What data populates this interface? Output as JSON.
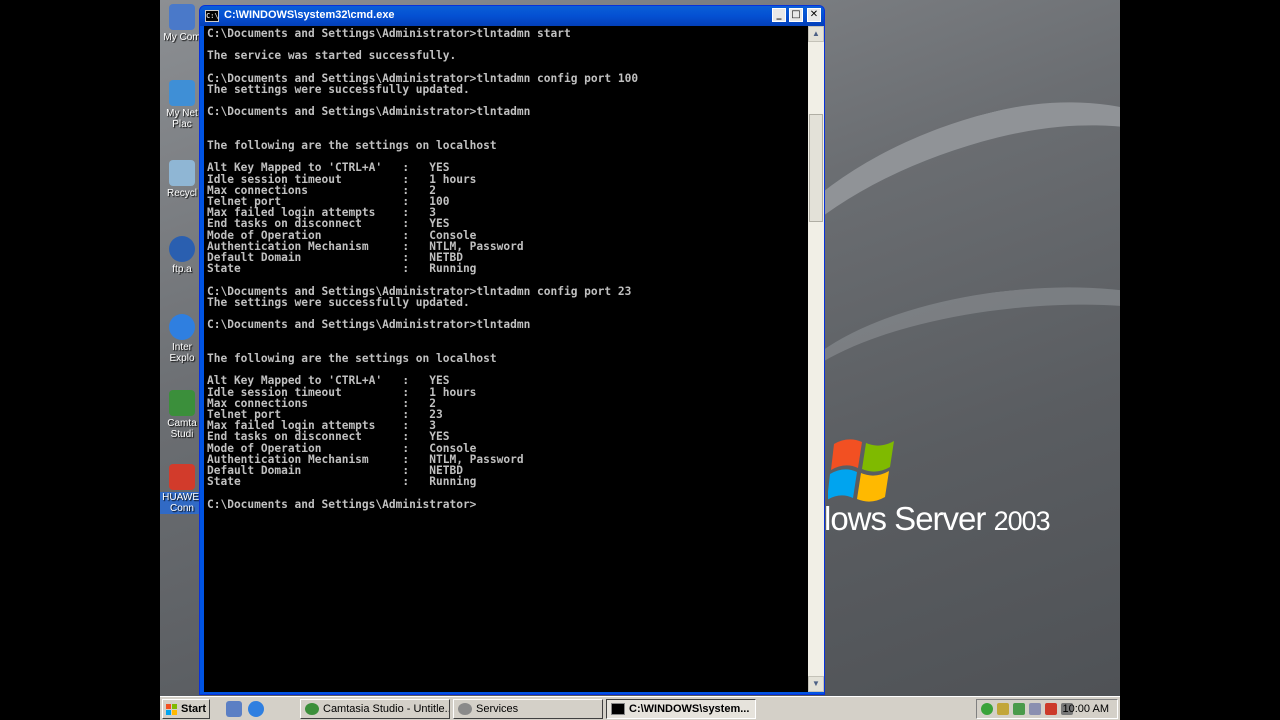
{
  "desktop": {
    "icons": [
      {
        "label": "My Com",
        "color": "#4a79c9"
      },
      {
        "label": "My Net\nPlac",
        "color": "#3f8fd6"
      },
      {
        "label": "Recycl",
        "color": "#8fb6d4"
      },
      {
        "label": "ftp.a",
        "color": "#2a5fb0"
      },
      {
        "label": "Inter\nExplo",
        "color": "#2f7fe0"
      },
      {
        "label": "Camta\nStudi",
        "color": "#3b8f3b"
      },
      {
        "label": "HUAWEI\nConn",
        "color": "#d23b2b"
      }
    ],
    "wallpaper_text": "lows Server",
    "wallpaper_version": "2003"
  },
  "window": {
    "title": "C:\\WINDOWS\\system32\\cmd.exe",
    "icon_text": "C:\\",
    "buttons": {
      "minimize": "_",
      "maximize": "□",
      "close": "✕"
    },
    "lines": [
      "C:\\Documents and Settings\\Administrator>tlntadmn start",
      "",
      "The service was started successfully.",
      "",
      "C:\\Documents and Settings\\Administrator>tlntadmn config port 100",
      "The settings were successfully updated.",
      "",
      "C:\\Documents and Settings\\Administrator>tlntadmn",
      "",
      "",
      "The following are the settings on localhost",
      "",
      "Alt Key Mapped to 'CTRL+A'   :   YES",
      "Idle session timeout         :   1 hours",
      "Max connections              :   2",
      "Telnet port                  :   100",
      "Max failed login attempts    :   3",
      "End tasks on disconnect      :   YES",
      "Mode of Operation            :   Console",
      "Authentication Mechanism     :   NTLM, Password",
      "Default Domain               :   NETBD",
      "State                        :   Running",
      "",
      "C:\\Documents and Settings\\Administrator>tlntadmn config port 23",
      "The settings were successfully updated.",
      "",
      "C:\\Documents and Settings\\Administrator>tlntadmn",
      "",
      "",
      "The following are the settings on localhost",
      "",
      "Alt Key Mapped to 'CTRL+A'   :   YES",
      "Idle session timeout         :   1 hours",
      "Max connections              :   2",
      "Telnet port                  :   23",
      "Max failed login attempts    :   3",
      "End tasks on disconnect      :   YES",
      "Mode of Operation            :   Console",
      "Authentication Mechanism     :   NTLM, Password",
      "Default Domain               :   NETBD",
      "State                        :   Running",
      "",
      "C:\\Documents and Settings\\Administrator>"
    ]
  },
  "taskbar": {
    "start_label": "Start",
    "tasks": [
      {
        "label": "Camtasia Studio - Untitle...",
        "active": false
      },
      {
        "label": "Services",
        "active": false
      },
      {
        "label": "C:\\WINDOWS\\system...",
        "active": true
      }
    ],
    "clock": "10:00 AM"
  }
}
